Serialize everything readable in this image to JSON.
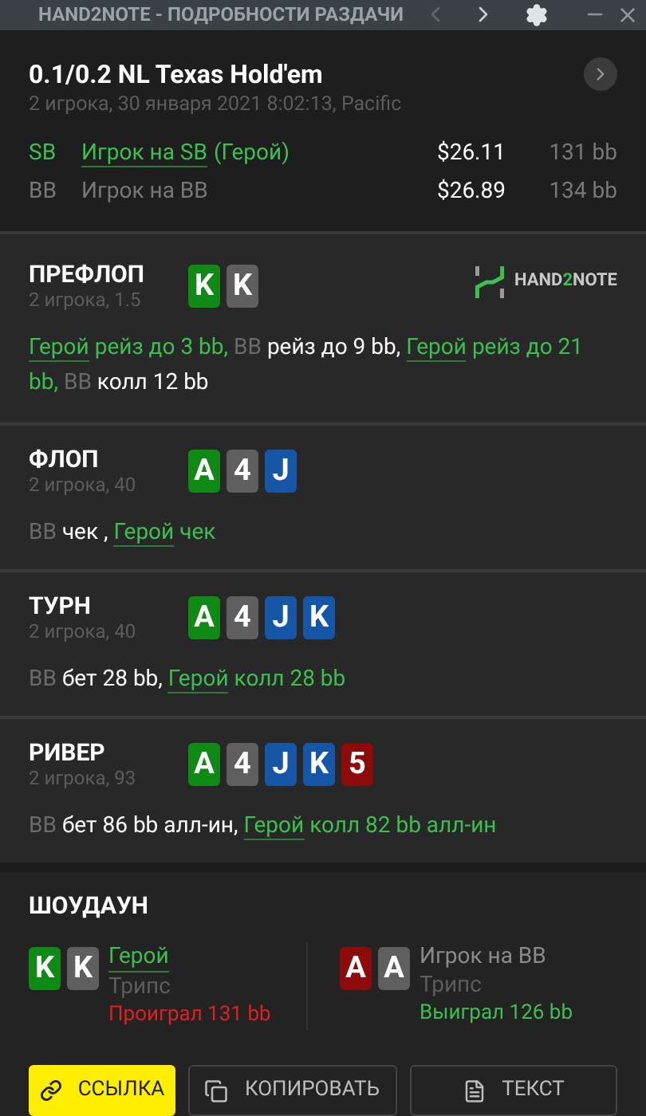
{
  "window": {
    "title": "HAND2NOTE - ПОДРОБНОСТИ РАЗДАЧИ",
    "prev_disabled": true
  },
  "hand": {
    "title": "0.1/0.2 NL Texas Hold'em",
    "subtitle": "2 игрока, 30 января 2021 8:02:13, Pacific",
    "players": [
      {
        "position": "SB",
        "name": "Игрок на SB",
        "hero": true,
        "suffix": "(Герой)",
        "stack": "$26.11",
        "bb": "131 bb"
      },
      {
        "position": "BB",
        "name": "Игрок на BB",
        "hero": false,
        "stack": "$26.89",
        "bb": "134 bb"
      }
    ]
  },
  "streets": [
    {
      "name": "ПРЕФЛОП",
      "info": "2 игрока, 1.5",
      "logo": {
        "left": "HAND",
        "mid": "2",
        "right": "NOTE"
      },
      "cards": [
        {
          "rank": "K",
          "color": "#0f8a14"
        },
        {
          "rank": "K",
          "color": "#5f5f5f"
        }
      ],
      "actions": [
        {
          "hero": true,
          "actor": "Герой",
          "text": "рейз до 3 bb,"
        },
        {
          "hero": false,
          "actor": "BB",
          "text": "рейз до 9 bb,"
        },
        {
          "hero": true,
          "actor": "Герой",
          "text": "рейз до 21 bb,"
        },
        {
          "hero": false,
          "actor": "BB",
          "text": "колл 12 bb"
        }
      ]
    },
    {
      "name": "ФЛОП",
      "info": "2 игрока, 40",
      "cards": [
        {
          "rank": "A",
          "color": "#0f8a14"
        },
        {
          "rank": "4",
          "color": "#5f5f5f"
        },
        {
          "rank": "J",
          "color": "#1656a6"
        }
      ],
      "actions": [
        {
          "hero": false,
          "actor": "BB",
          "text": "чек ,"
        },
        {
          "hero": true,
          "actor": "Герой",
          "text": "чек"
        }
      ]
    },
    {
      "name": "ТУРН",
      "info": "2 игрока, 40",
      "cards": [
        {
          "rank": "A",
          "color": "#0f8a14"
        },
        {
          "rank": "4",
          "color": "#5f5f5f"
        },
        {
          "rank": "J",
          "color": "#1656a6"
        },
        {
          "rank": "K",
          "color": "#1656a6"
        }
      ],
      "actions": [
        {
          "hero": false,
          "actor": "BB",
          "text": "бет 28 bb,"
        },
        {
          "hero": true,
          "actor": "Герой",
          "text": "колл 28 bb"
        }
      ]
    },
    {
      "name": "РИВЕР",
      "info": "2 игрока, 93",
      "cards": [
        {
          "rank": "A",
          "color": "#0f8a14"
        },
        {
          "rank": "4",
          "color": "#5f5f5f"
        },
        {
          "rank": "J",
          "color": "#1656a6"
        },
        {
          "rank": "K",
          "color": "#1656a6"
        },
        {
          "rank": "5",
          "color": "#8c0a0a"
        }
      ],
      "actions": [
        {
          "hero": false,
          "actor": "BB",
          "text": "бет 86 bb алл-ин,"
        },
        {
          "hero": true,
          "actor": "Герой",
          "text": "колл 82 bb алл-ин"
        }
      ]
    }
  ],
  "showdown": {
    "title": "ШОУДАУН",
    "players": [
      {
        "name": "Герой",
        "hero": true,
        "hand": "Трипс",
        "result": "Проиграл 131 bb",
        "won": false,
        "cards": [
          {
            "rank": "K",
            "color": "#0f8a14"
          },
          {
            "rank": "K",
            "color": "#5f5f5f"
          }
        ]
      },
      {
        "name": "Игрок на BB",
        "hero": false,
        "hand": "Трипс",
        "result": "Выиграл 126 bb",
        "won": true,
        "cards": [
          {
            "rank": "A",
            "color": "#8c0a0a"
          },
          {
            "rank": "A",
            "color": "#5f5f5f"
          }
        ]
      }
    ]
  },
  "buttons": [
    {
      "label": "ССЫЛКА",
      "kind": "link",
      "primary": true
    },
    {
      "label": "КОПИРОВАТЬ",
      "kind": "copy",
      "primary": false
    },
    {
      "label": "ТЕКСТ",
      "kind": "text",
      "primary": false
    }
  ]
}
